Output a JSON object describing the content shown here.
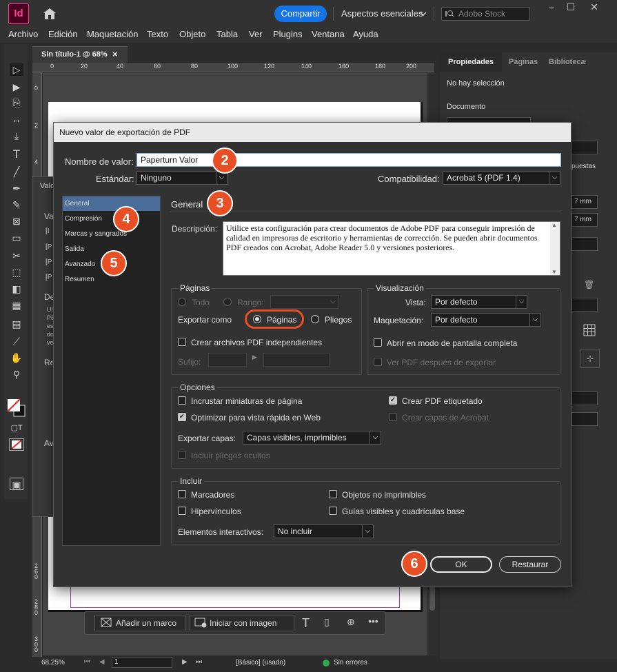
{
  "app": {
    "logo": "Id",
    "share": "Compartir",
    "workspace": "Aspectos esenciales",
    "stock_placeholder": "Adobe Stock"
  },
  "menu": [
    "Archivo",
    "Edición",
    "Maquetación",
    "Texto",
    "Objeto",
    "Tabla",
    "Ver",
    "Plugins",
    "Ventana",
    "Ayuda"
  ],
  "doc_tab": "Sin título-1 @ 68%",
  "doc_tab_close": "×",
  "ruler_h": [
    "0",
    "20",
    "40",
    "60",
    "80",
    "100",
    "120",
    "140",
    "160",
    "180",
    "200"
  ],
  "ruler_v": [
    "0",
    "2",
    "4",
    "260",
    "280",
    "300"
  ],
  "right_panel": {
    "tabs": [
      "Propiedades",
      "Páginas",
      "Bibliotecas"
    ],
    "no_selection": "No hay selección",
    "document": "Documento",
    "vals": [
      "7 mm",
      "7 mm"
    ],
    "partial": "puestas"
  },
  "bg_dialog": {
    "title": "Valo",
    "va": "Va",
    "de": "De",
    "re": "Re",
    "av": "Av",
    "rows": [
      "[I",
      "[P",
      "[P",
      "[P"
    ],
    "lines": [
      "Ul",
      "PE",
      "es",
      "do",
      "ve"
    ]
  },
  "dialog": {
    "title": "Nuevo valor de exportación de PDF",
    "name_label": "Nombre de valor:",
    "name_value": "Paperturn Valor",
    "standard_label": "Estándar:",
    "standard_value": "Ninguno",
    "compat_label": "Compatibilidad:",
    "compat_value": "Acrobat 5 (PDF 1.4)",
    "sections": [
      "General",
      "Compresión",
      "Marcas y sangrados",
      "Salida",
      "Avanzado",
      "Resumen"
    ],
    "general_heading": "General",
    "desc_label": "Descripción:",
    "desc_text": "Utilice esta configuración para crear documentos de Adobe PDF para conseguir impresión de calidad en impresoras de escritorio y herramientas de corrección. Se pueden abrir documentos PDF creados con Acrobat, Adobe Reader 5.0 y versiones posteriores.",
    "pages": {
      "title": "Páginas",
      "all": "Todo",
      "range": "Rango:",
      "export_as": "Exportar como",
      "pages": "Páginas",
      "spreads": "Pliegos",
      "separate": "Crear archivos PDF independientes",
      "suffix": "Sufijo:"
    },
    "visual": {
      "title": "Visualización",
      "view_label": "Vista:",
      "view_value": "Por defecto",
      "layout_label": "Maquetación:",
      "layout_value": "Por defecto",
      "fullscreen": "Abrir en modo de pantalla completa",
      "view_after": "Ver PDF después de exportar"
    },
    "options": {
      "title": "Opciones",
      "thumbnails": "Incrustar miniaturas de página",
      "fastweb": "Optimizar para vista rápida en Web",
      "tagged": "Crear PDF etiquetado",
      "acrolayers": "Crear capas de Acrobat",
      "layers_label": "Exportar capas:",
      "layers_value": "Capas visibles, imprimibles",
      "hidden": "Incluir pliegos ocultos"
    },
    "include": {
      "title": "Incluir",
      "bookmarks": "Marcadores",
      "hyperlinks": "Hipervínculos",
      "nonprint": "Objetos no imprimibles",
      "guides": "Guías visibles y cuadrículas base",
      "interactive_label": "Elementos interactivos:",
      "interactive_value": "No incluir"
    },
    "ok": "OK",
    "reset": "Restaurar"
  },
  "badges": [
    "2",
    "3",
    "4",
    "5",
    "6"
  ],
  "floatbar": {
    "add_frame": "Añadir un marco",
    "start_image": "Iniciar con imagen"
  },
  "status": {
    "zoom": "68,25%",
    "page": "1",
    "style": "[Básico] (usado)",
    "errors": "Sin errores"
  },
  "colors": {
    "accent": "#1473e6",
    "badge": "#e94f25",
    "highlight": "#4b6d99"
  }
}
